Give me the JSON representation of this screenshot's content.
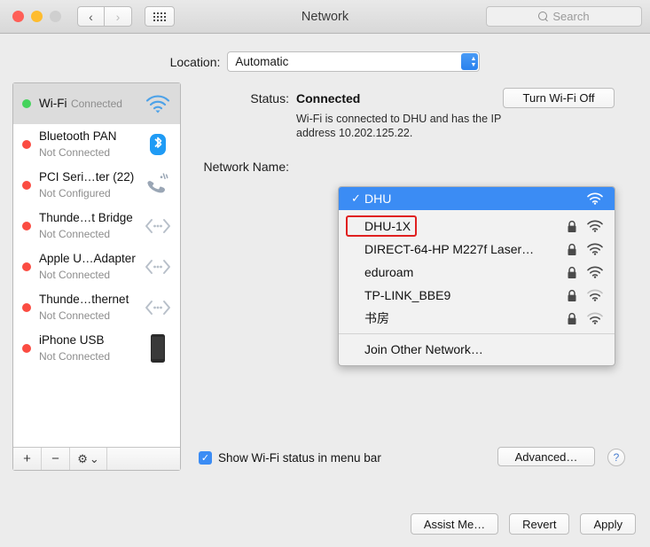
{
  "window": {
    "title": "Network",
    "traffic_lights": [
      "close",
      "minimize",
      "zoom"
    ],
    "nav_back": "‹",
    "nav_forward": "›",
    "grid_icon": "grid-icon"
  },
  "search": {
    "placeholder": "Search",
    "icon": "search-icon"
  },
  "location": {
    "label": "Location:",
    "value": "Automatic"
  },
  "sidebar": {
    "items": [
      {
        "name": "Wi-Fi",
        "state": "Connected",
        "status_color": "green",
        "icon": "wifi-icon",
        "selected": true
      },
      {
        "name": "Bluetooth PAN",
        "state": "Not Connected",
        "status_color": "red",
        "icon": "bluetooth-icon",
        "selected": false
      },
      {
        "name": "PCI Seri…ter (22)",
        "state": "Not Configured",
        "status_color": "red",
        "icon": "modem-phone-icon",
        "selected": false
      },
      {
        "name": "Thunde…t Bridge",
        "state": "Not Connected",
        "status_color": "red",
        "icon": "thunderbolt-bridge-icon",
        "selected": false
      },
      {
        "name": "Apple U…Adapter",
        "state": "Not Connected",
        "status_color": "red",
        "icon": "ethernet-adapter-icon",
        "selected": false
      },
      {
        "name": "Thunde…thernet",
        "state": "Not Connected",
        "status_color": "red",
        "icon": "thunderbolt-ethernet-icon",
        "selected": false
      },
      {
        "name": "iPhone USB",
        "state": "Not Connected",
        "status_color": "red",
        "icon": "iphone-icon",
        "selected": false
      }
    ],
    "footer": {
      "add": "+",
      "remove": "−",
      "gear": "gear-icon",
      "gear_chevron": "⌄"
    }
  },
  "pane": {
    "status_label": "Status:",
    "status_value": "Connected",
    "turn_wifi_button": "Turn Wi-Fi Off",
    "status_description": "Wi-Fi is connected to DHU and has the IP address 10.202.125.22.",
    "network_name_label": "Network Name:",
    "show_status_checkbox": {
      "label": "Show Wi-Fi status in menu bar",
      "checked": true,
      "mark": "✓"
    },
    "advanced_button": "Advanced…",
    "help_button": "?"
  },
  "dropdown": {
    "selected": {
      "label": "DHU",
      "check": "✓",
      "secured": false,
      "signal": 3
    },
    "networks": [
      {
        "label": "DHU-1X",
        "secured": true,
        "signal": 3,
        "highlighted": true
      },
      {
        "label": "DIRECT-64-HP M227f Laser…",
        "secured": true,
        "signal": 3,
        "highlighted": false
      },
      {
        "label": "eduroam",
        "secured": true,
        "signal": 3,
        "highlighted": false
      },
      {
        "label": "TP-LINK_BBE9",
        "secured": true,
        "signal": 2,
        "highlighted": false
      },
      {
        "label": "书房",
        "secured": true,
        "signal": 2,
        "highlighted": false
      }
    ],
    "join_other": "Join Other Network…"
  },
  "footer_buttons": {
    "assist": "Assist Me…",
    "revert": "Revert",
    "apply": "Apply"
  },
  "colors": {
    "accent_blue": "#3b8cf4",
    "connected_green": "#45d35c",
    "disconnected_red": "#fb4c42",
    "annotation_red": "#e02020"
  }
}
